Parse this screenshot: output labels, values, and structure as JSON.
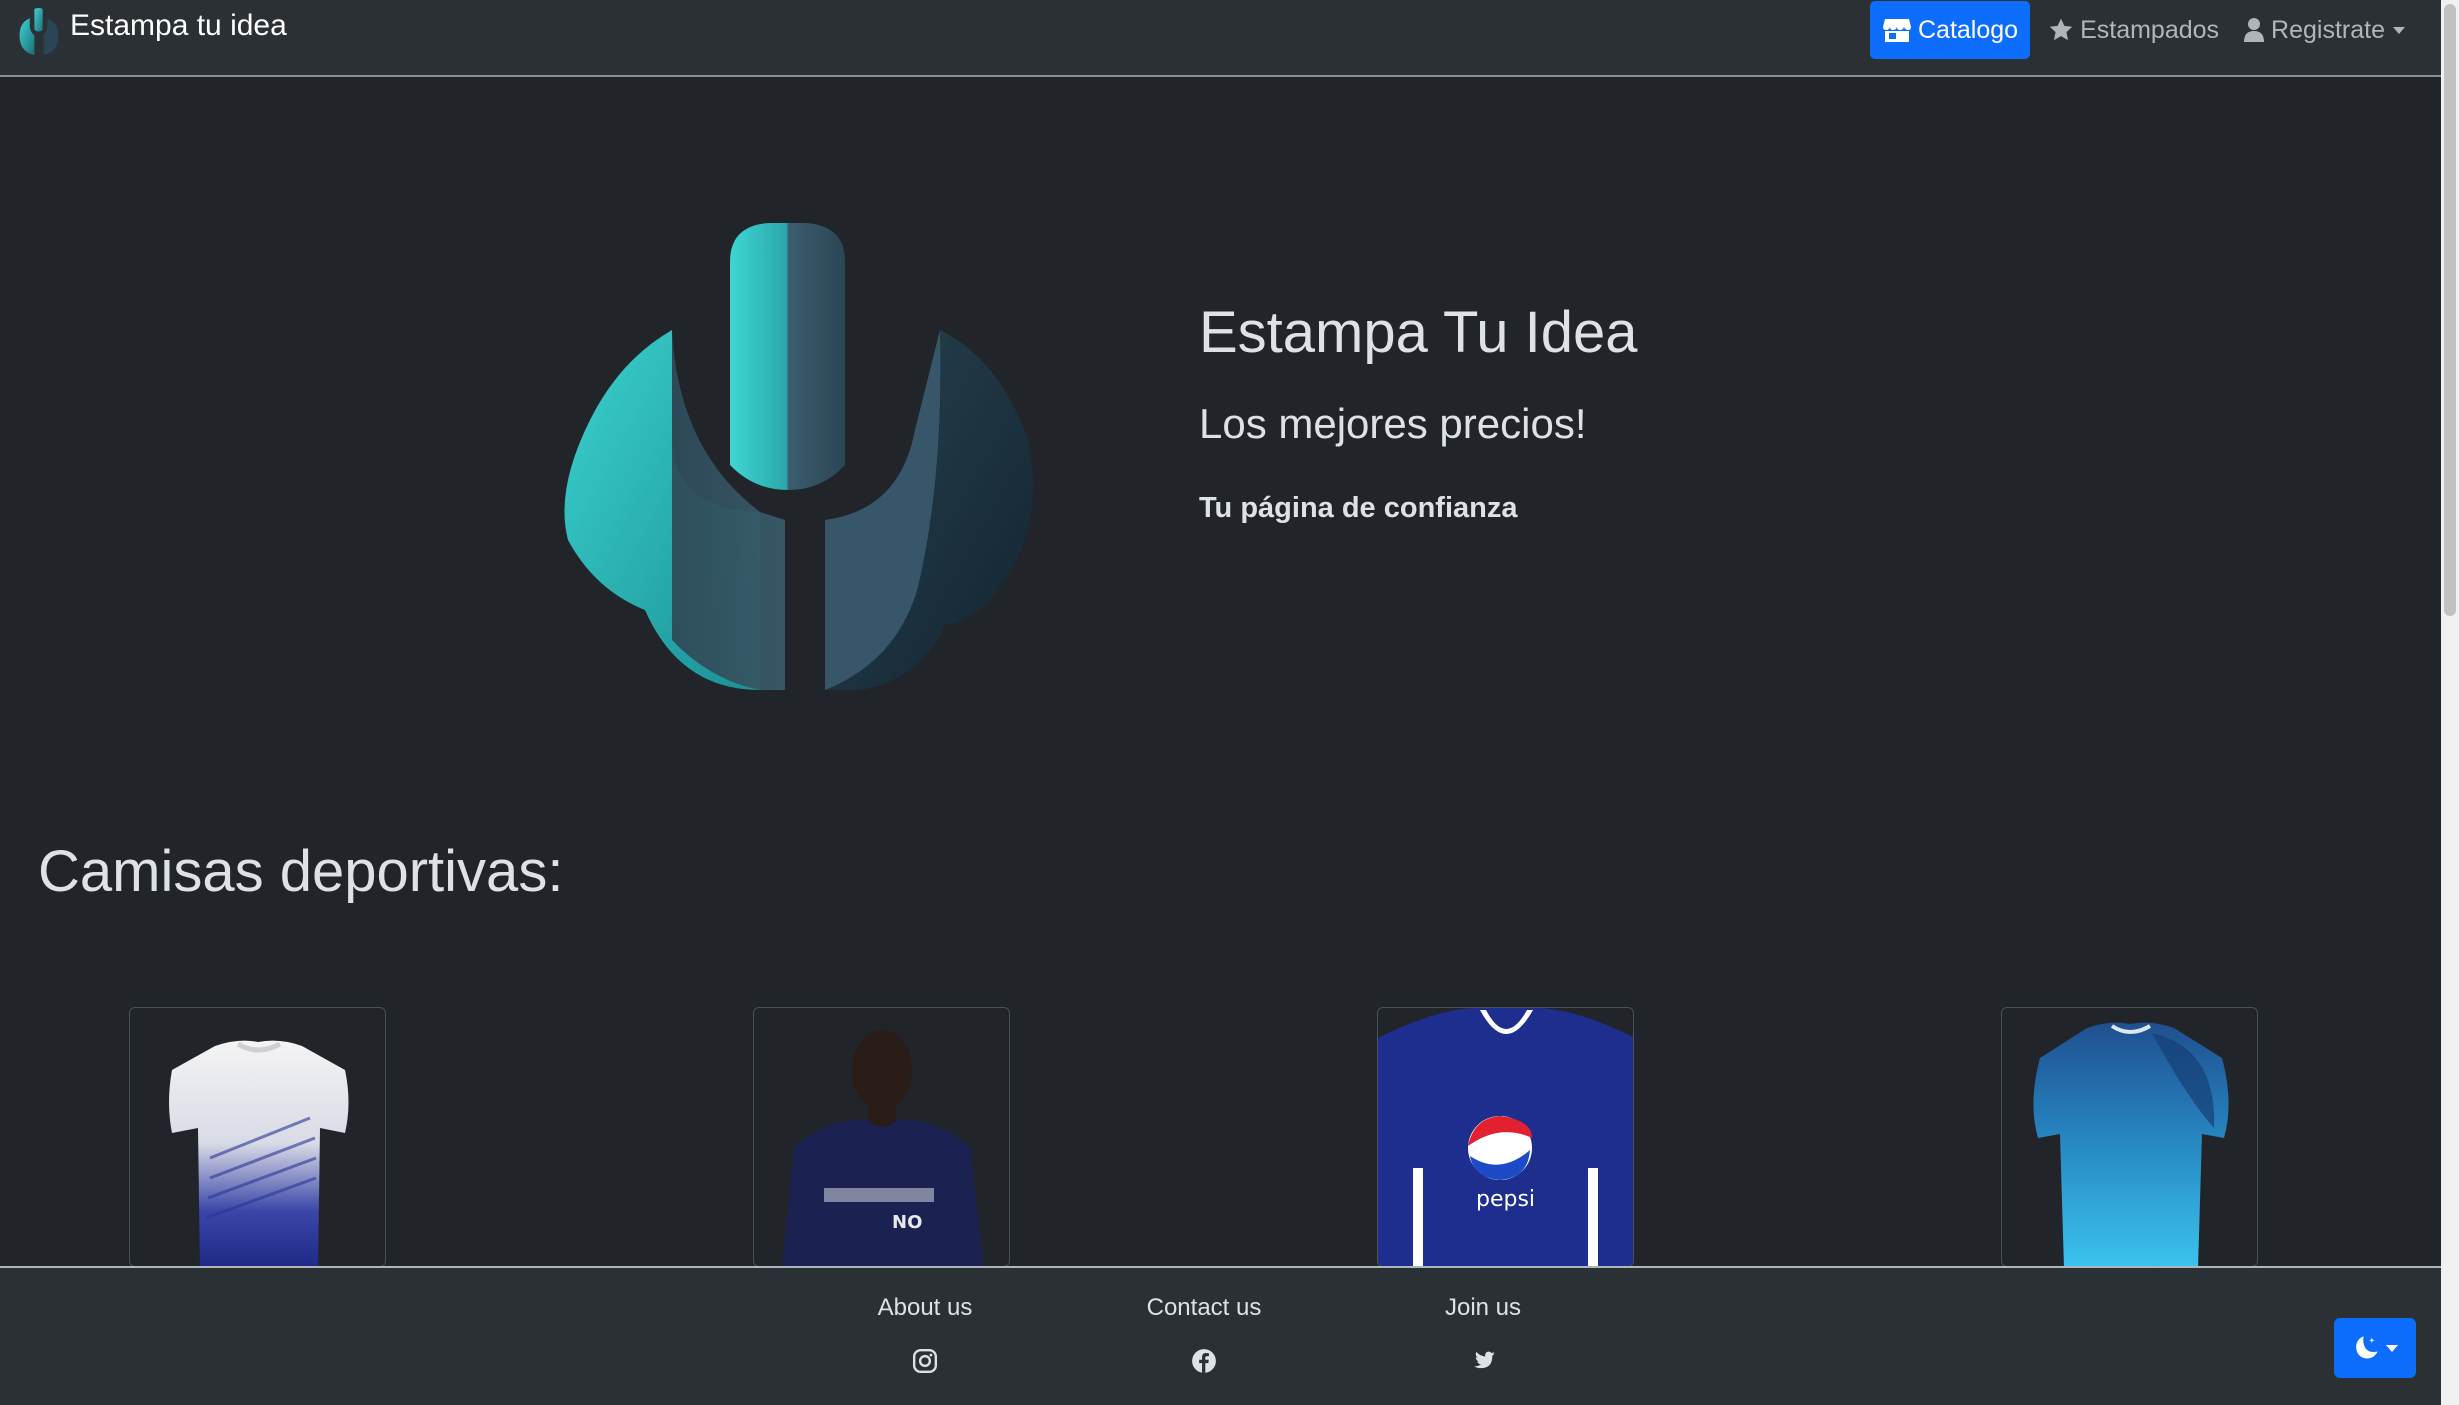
{
  "navbar": {
    "brand": "Estampa tu idea",
    "items": [
      {
        "label": "Catalogo",
        "icon": "shop-icon",
        "active": true
      },
      {
        "label": "Estampados",
        "icon": "star-icon",
        "active": false
      },
      {
        "label": "Registrate",
        "icon": "person-icon",
        "active": false,
        "dropdown": true
      }
    ]
  },
  "hero": {
    "title": "Estampa Tu Idea",
    "subtitle": "Los mejores precios!",
    "tagline": "Tu página de confianza"
  },
  "section": {
    "title": "Camisas deportivas:"
  },
  "products": [
    {
      "name": "white-blue-jersey"
    },
    {
      "name": "navy-tshirt-model"
    },
    {
      "name": "millonarios-pepsi-jersey"
    },
    {
      "name": "blue-gradient-jersey"
    }
  ],
  "footer": {
    "links": [
      {
        "label": "About us",
        "icon": "instagram-icon"
      },
      {
        "label": "Contact us",
        "icon": "facebook-icon"
      },
      {
        "label": "Join us",
        "icon": "twitter-icon"
      }
    ],
    "theme_toggle_icon": "moon-icon"
  },
  "colors": {
    "accent": "#0d6efd",
    "background": "#212529",
    "navbar": "#2b3035",
    "logo_teal": "#35c2c1",
    "logo_dark": "#1f3341"
  }
}
